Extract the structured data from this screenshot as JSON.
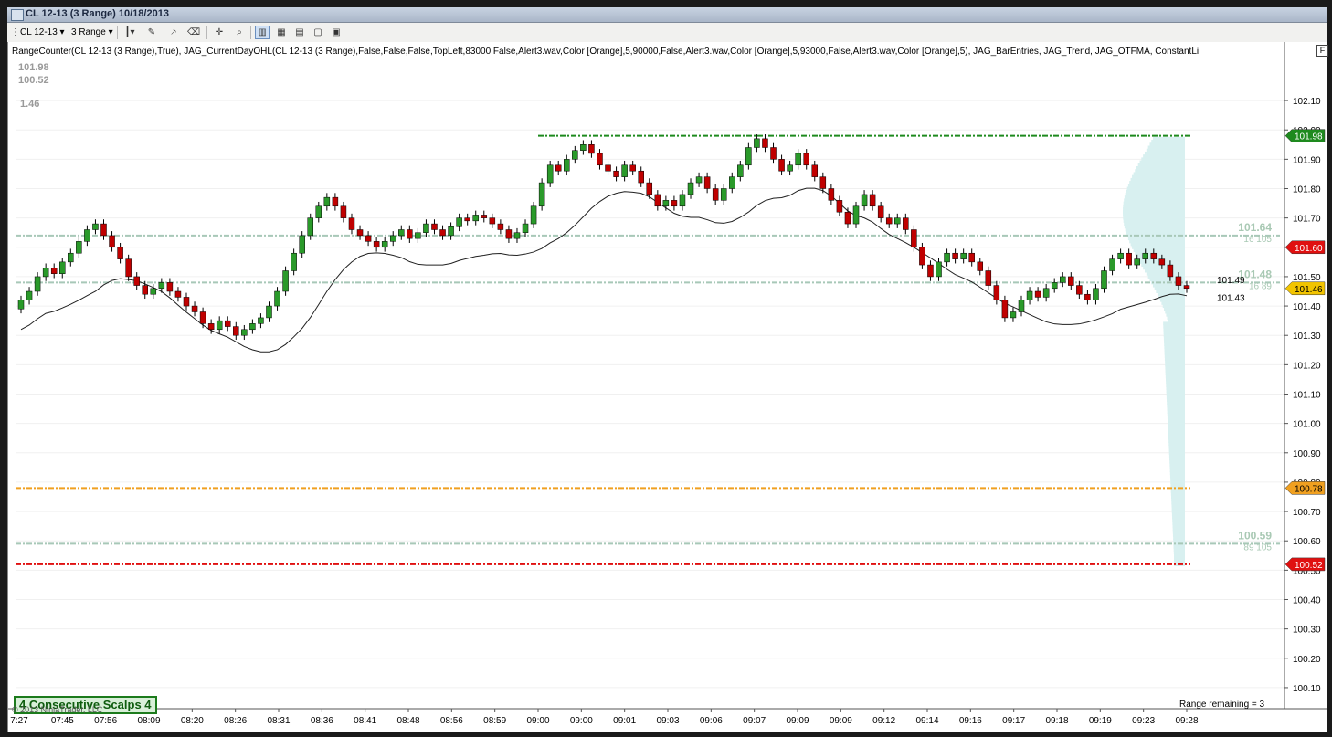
{
  "window": {
    "title": "CL 12-13 (3 Range)  10/18/2013"
  },
  "toolbar": {
    "instrument": "CL 12-13",
    "bar_type": "3 Range",
    "icons": [
      "bar-type-icon",
      "drawing-tool-icon",
      "brush-icon",
      "crosshair-icon",
      "zoom-icon",
      "chart-style-icon",
      "data-box-icon",
      "properties-icon",
      "trade-icon",
      "template-icon"
    ]
  },
  "indicator_line": "RangeCounter(CL 12-13 (3 Range),True),  JAG_CurrentDayOHL(CL 12-13 (3 Range),False,False,False,TopLeft,83000,False,Alert3.wav,Color [Orange],5,90000,False,Alert3.wav,Color [Orange],5,93000,False,Alert3.wav,Color [Orange],5), JAG_BarEntries,  JAG_Trend,  JAG_OTFMA, ConstantLi",
  "corner_button": "F",
  "ohl_panel": {
    "high": "101.98",
    "low": "100.52",
    "range": "1.46"
  },
  "scalps_box": "4  Consecutive Scalps 4",
  "copyright": "© 2013 NinjaTrader, LLC",
  "range_remaining": "Range remaining = 3",
  "colors": {
    "up_candle": "#2a9a2a",
    "down_candle": "#c00000",
    "high_line": "#1e8a1e",
    "low_line": "#e01010",
    "open_line": "#f0a020",
    "profile": "#d8f0f0",
    "value_area_line": "#a8c8b8",
    "ma_line": "#202020"
  },
  "chart_data": {
    "type": "candlestick",
    "y_ticks": [
      "102.10",
      "102.00",
      "101.90",
      "101.80",
      "101.70",
      "101.60",
      "101.50",
      "101.40",
      "101.30",
      "101.20",
      "101.10",
      "101.00",
      "100.90",
      "100.80",
      "100.70",
      "100.60",
      "100.50",
      "100.40",
      "100.30",
      "100.20",
      "100.10"
    ],
    "ylim": [
      100.05,
      102.15
    ],
    "x_ticks": [
      "7:27",
      "07:45",
      "07:56",
      "08:09",
      "08:20",
      "08:26",
      "08:31",
      "08:36",
      "08:41",
      "08:48",
      "08:56",
      "08:59",
      "09:00",
      "09:00",
      "09:01",
      "09:03",
      "09:06",
      "09:07",
      "09:09",
      "09:09",
      "09:12",
      "09:14",
      "09:16",
      "09:17",
      "09:18",
      "09:19",
      "09:23",
      "09:28"
    ],
    "price_tags": [
      {
        "label": "101.98",
        "value": 101.98,
        "color": "#1e8a1e"
      },
      {
        "label": "101.60",
        "value": 101.6,
        "color": "#e01010"
      },
      {
        "label": "101.46",
        "value": 101.46,
        "color": "#f2c400"
      },
      {
        "label": "100.78",
        "value": 100.78,
        "color": "#f0a020"
      },
      {
        "label": "100.52",
        "value": 100.52,
        "color": "#e01010"
      }
    ],
    "levels": [
      {
        "name": "high",
        "value": 101.98
      },
      {
        "name": "open",
        "value": 100.78
      },
      {
        "name": "low",
        "value": 100.52
      }
    ],
    "value_area": [
      {
        "price": "101.64",
        "volume": "16  105",
        "value": 101.64
      },
      {
        "price": "101.48",
        "volume": "16  89",
        "value": 101.48
      },
      {
        "price": "100.59",
        "volume": "89  105",
        "value": 100.59
      }
    ],
    "close_labels": [
      {
        "label": "101.49",
        "value": 101.49
      },
      {
        "label": "101.43",
        "value": 101.43
      }
    ],
    "closes": [
      101.42,
      101.45,
      101.5,
      101.53,
      101.51,
      101.55,
      101.58,
      101.62,
      101.66,
      101.68,
      101.64,
      101.6,
      101.56,
      101.5,
      101.47,
      101.44,
      101.46,
      101.48,
      101.45,
      101.43,
      101.4,
      101.38,
      101.34,
      101.32,
      101.35,
      101.33,
      101.3,
      101.32,
      101.34,
      101.36,
      101.4,
      101.45,
      101.52,
      101.58,
      101.64,
      101.7,
      101.74,
      101.77,
      101.74,
      101.7,
      101.66,
      101.64,
      101.62,
      101.6,
      101.62,
      101.64,
      101.66,
      101.63,
      101.65,
      101.68,
      101.66,
      101.64,
      101.67,
      101.7,
      101.69,
      101.71,
      101.7,
      101.68,
      101.66,
      101.63,
      101.65,
      101.68,
      101.74,
      101.82,
      101.88,
      101.86,
      101.9,
      101.93,
      101.95,
      101.92,
      101.88,
      101.86,
      101.84,
      101.88,
      101.86,
      101.82,
      101.78,
      101.74,
      101.76,
      101.74,
      101.78,
      101.82,
      101.84,
      101.8,
      101.76,
      101.8,
      101.84,
      101.88,
      101.94,
      101.97,
      101.94,
      101.9,
      101.86,
      101.88,
      101.92,
      101.88,
      101.84,
      101.8,
      101.76,
      101.72,
      101.68,
      101.74,
      101.78,
      101.74,
      101.7,
      101.68,
      101.7,
      101.66,
      101.6,
      101.54,
      101.5,
      101.55,
      101.58,
      101.56,
      101.58,
      101.55,
      101.52,
      101.47,
      101.42,
      101.36,
      101.38,
      101.42,
      101.45,
      101.43,
      101.46,
      101.48,
      101.5,
      101.47,
      101.44,
      101.42,
      101.46,
      101.52,
      101.56,
      101.58,
      101.54,
      101.56,
      101.58,
      101.56,
      101.54,
      101.5,
      101.47,
      101.46
    ]
  }
}
